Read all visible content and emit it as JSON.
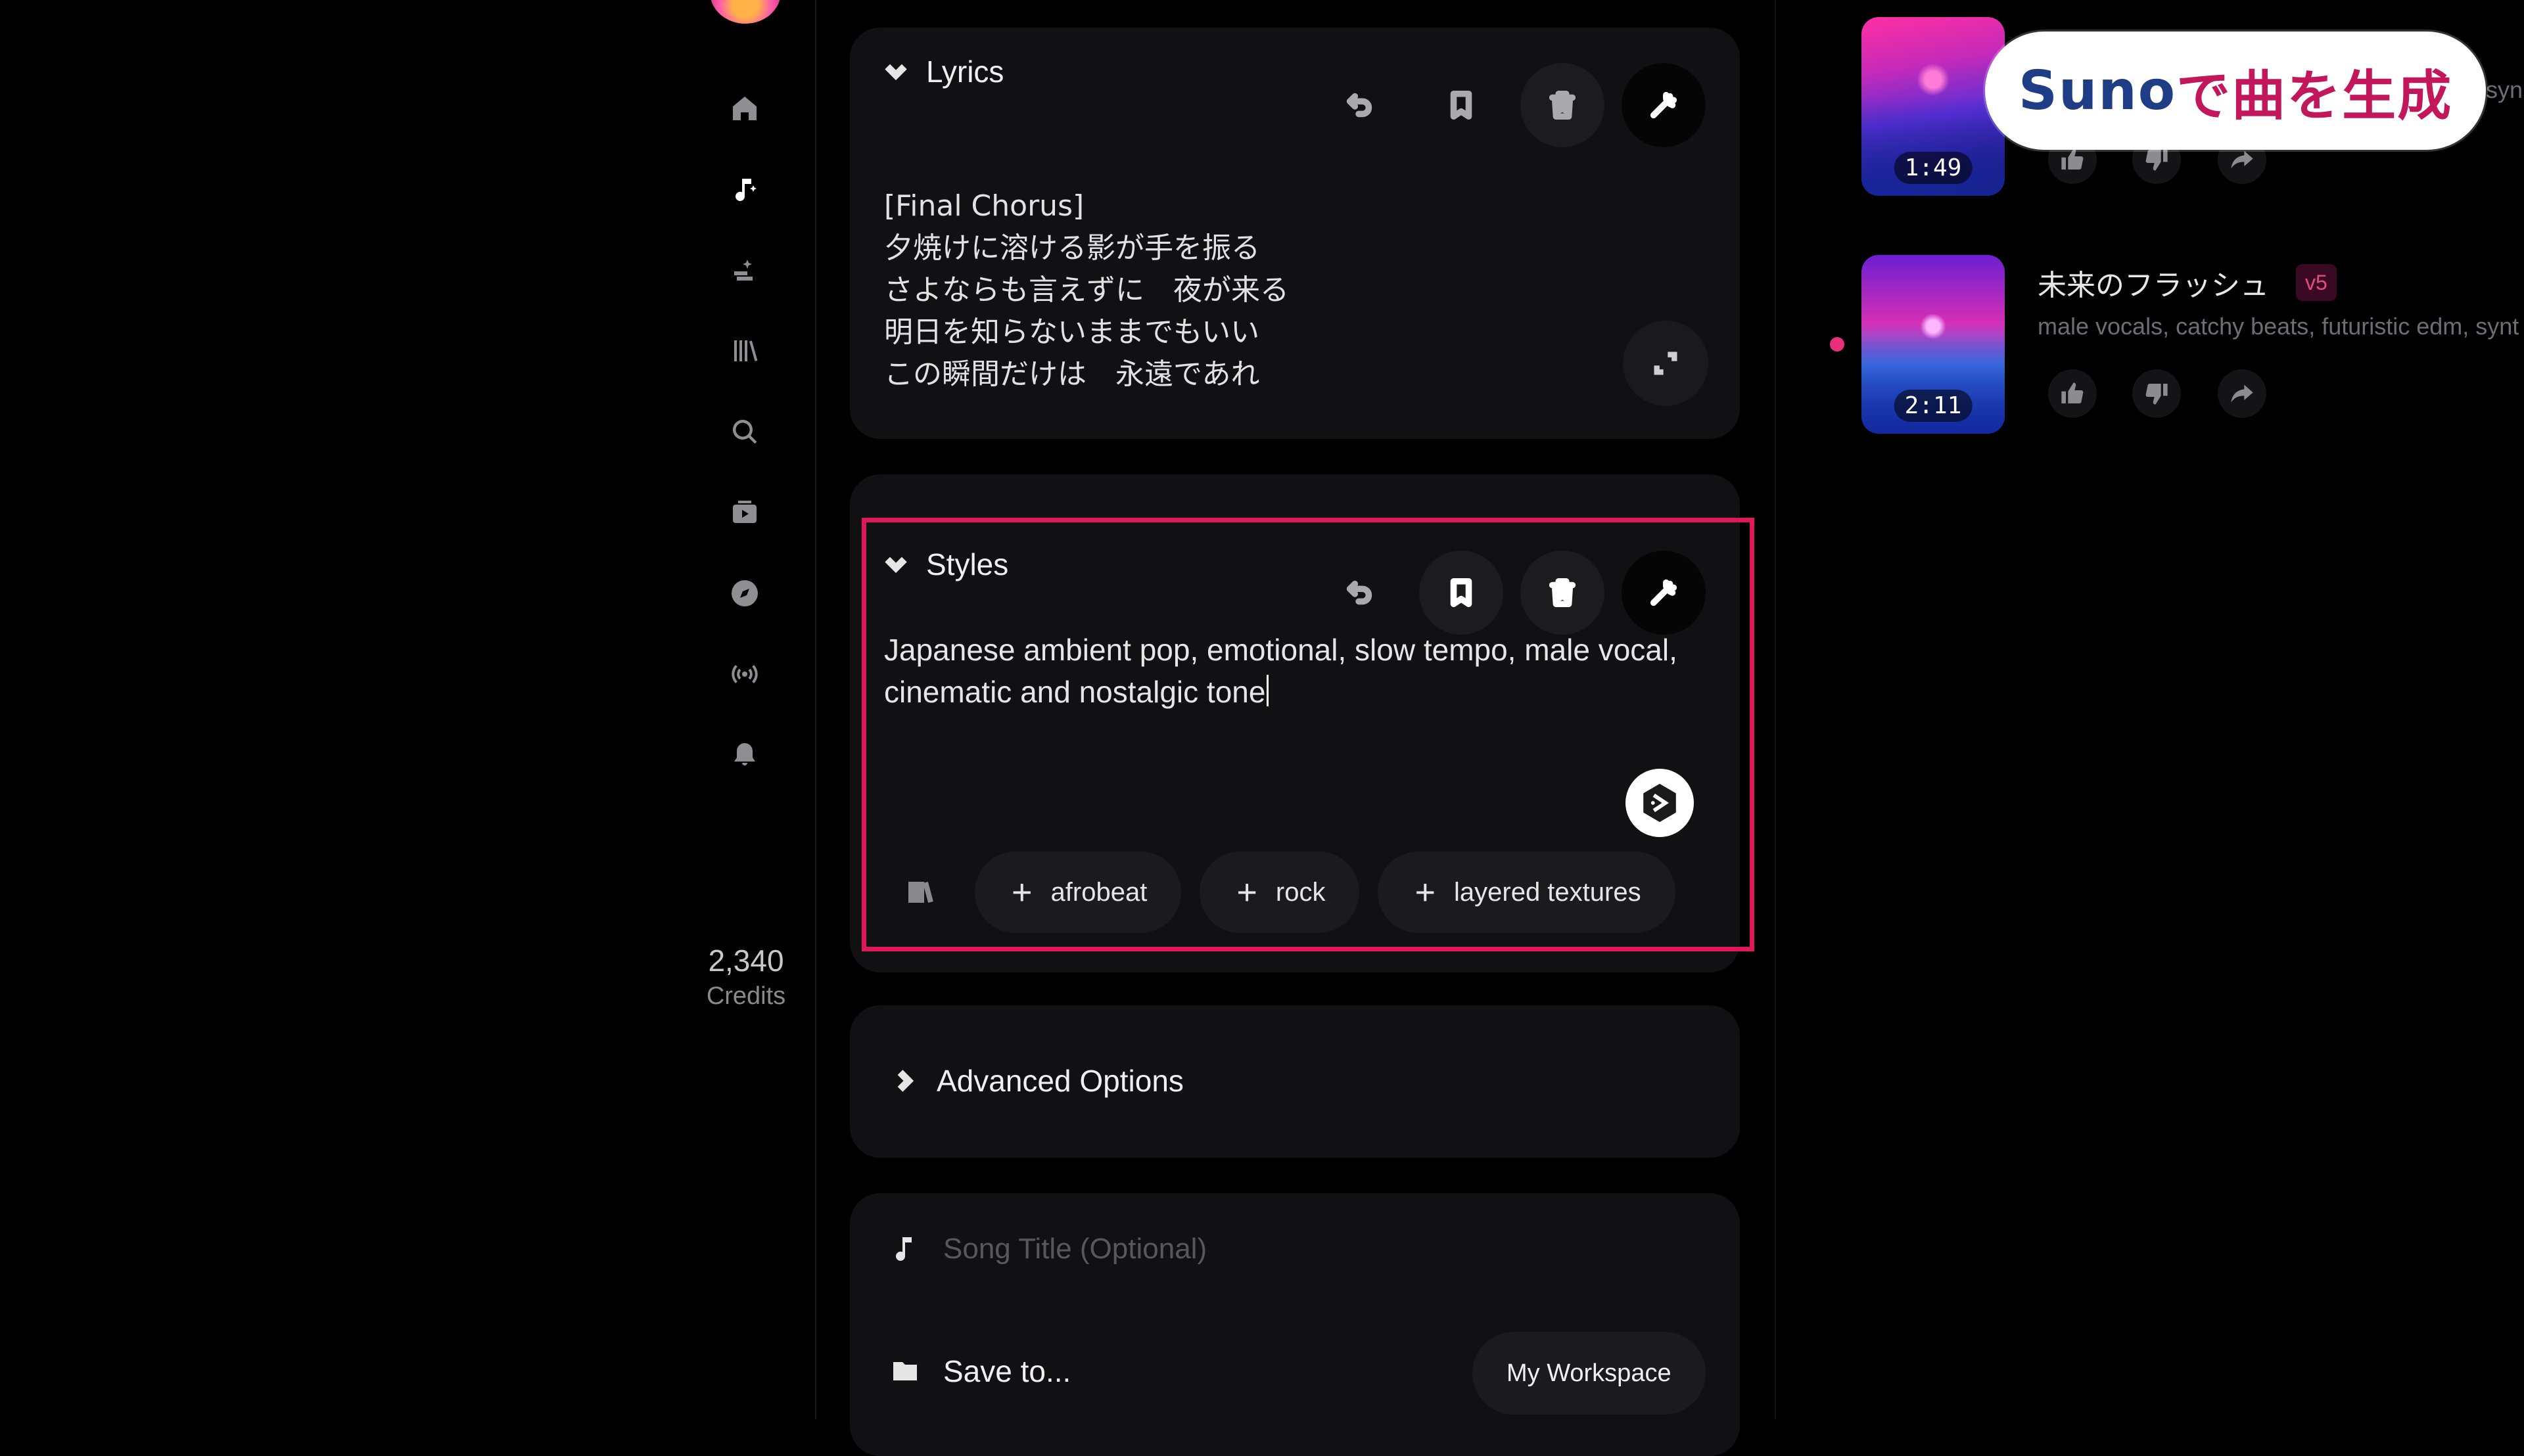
{
  "sidebar": {
    "nav": [
      {
        "icon": "home-icon"
      },
      {
        "icon": "create-music-icon",
        "active": true
      },
      {
        "icon": "studio-icon"
      },
      {
        "icon": "library-icon"
      },
      {
        "icon": "search-icon"
      },
      {
        "icon": "video-icon"
      },
      {
        "icon": "explore-compass-icon"
      },
      {
        "icon": "radio-broadcast-icon"
      },
      {
        "icon": "bell-icon"
      }
    ],
    "credits_value": "2,340",
    "credits_label": "Credits"
  },
  "lyrics_panel": {
    "title": "Lyrics",
    "lines": "[Final Chorus]\n夕焼けに溶ける影が手を振る\nさよならも言えずに　夜が来る\n明日を知らないままでもいい\nこの瞬間だけは　永遠であれ"
  },
  "styles_panel": {
    "title": "Styles",
    "text": "Japanese ambient pop, emotional, slow tempo, male vocal, cinematic and nostalgic tone",
    "tags": [
      "afrobeat",
      "rock",
      "layered textures"
    ]
  },
  "advanced": {
    "title": "Advanced Options"
  },
  "song_title_field": {
    "placeholder": "Song Title (Optional)"
  },
  "save": {
    "label": "Save to...",
    "workspace": "My Workspace"
  },
  "songs": [
    {
      "duration": "1:49"
    },
    {
      "title": "未来のフラッシュ",
      "version": "v5",
      "tags": "male vocals, catchy beats, futuristic edm, synt",
      "duration": "2:11"
    }
  ],
  "clipped_tag": "syn",
  "overlay": {
    "part1": "Suno",
    "part2": "で曲を生成"
  },
  "colors": {
    "highlight": "#e0175a",
    "accent_pink": "#ea2e7c",
    "background": "#000000",
    "panel": "#111113"
  }
}
